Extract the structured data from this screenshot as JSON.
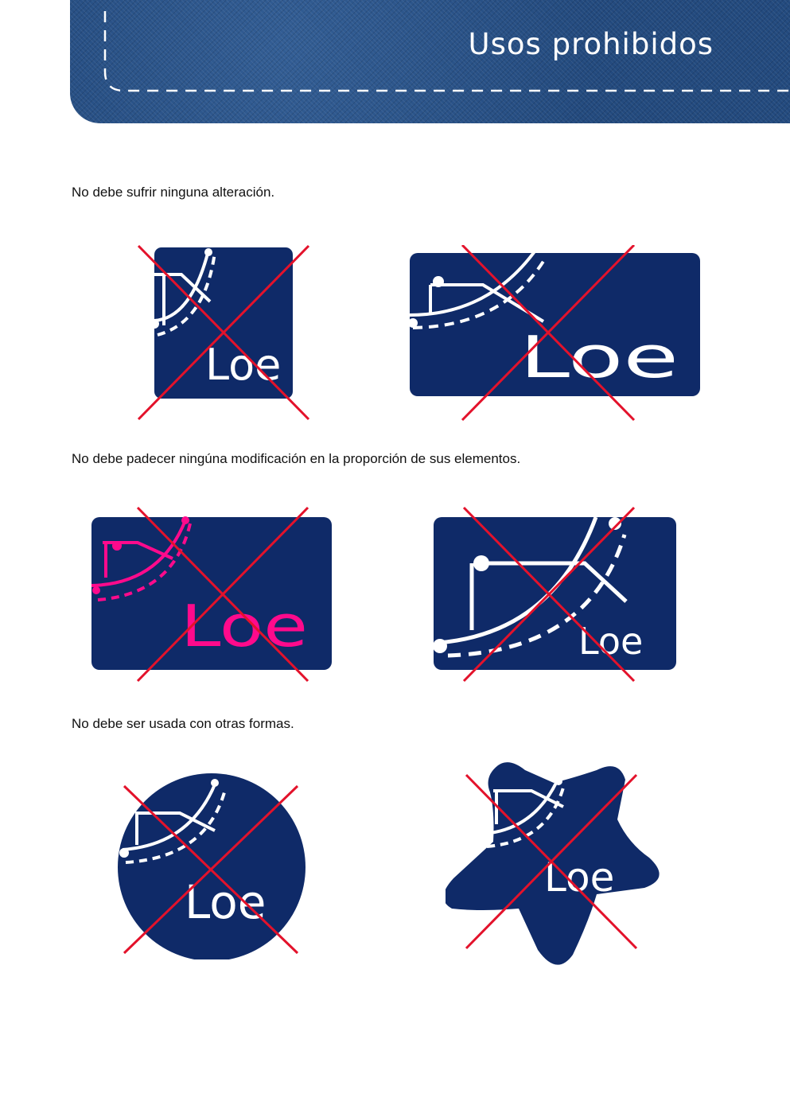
{
  "header": {
    "title": "Usos prohibidos"
  },
  "sections": [
    {
      "caption": "No debe sufrir ninguna alteración."
    },
    {
      "caption": "No debe padecer ningúna modificación en la proporción de sus elementos."
    },
    {
      "caption": "No debe ser usada con otras formas."
    }
  ],
  "logo": {
    "text": "Loe"
  },
  "colors": {
    "brand_navy": "#0f2a68",
    "logo_white": "#ffffff",
    "altered_pink": "#ff0a8c",
    "cross_red": "#e3122b",
    "denim": "#234a7e"
  }
}
